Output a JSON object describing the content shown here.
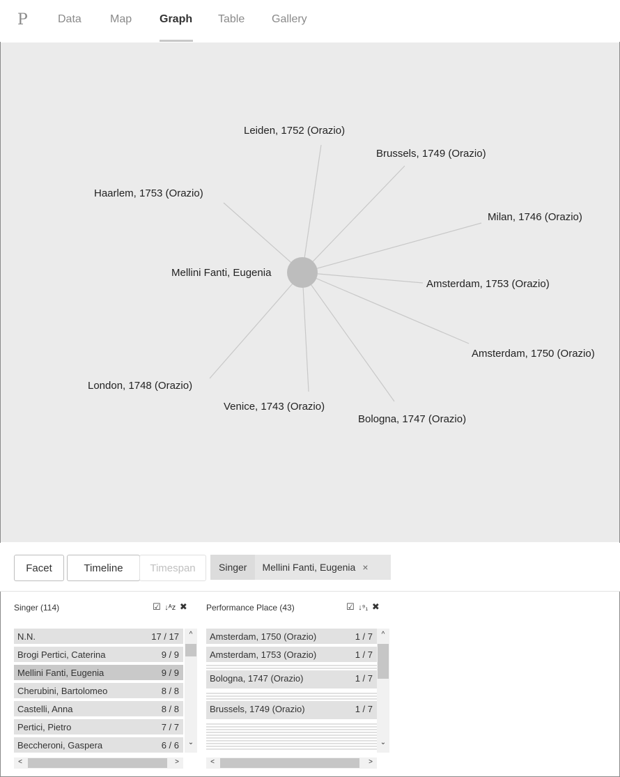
{
  "nav": {
    "logo": "P",
    "tabs": [
      {
        "label": "Data"
      },
      {
        "label": "Map"
      },
      {
        "label": "Graph"
      },
      {
        "label": "Table"
      },
      {
        "label": "Gallery"
      }
    ],
    "active_tab": "Graph"
  },
  "graph": {
    "center": "Mellini Fanti, Eugenia",
    "nodes": [
      "Leiden, 1752 (Orazio)",
      "Brussels, 1749 (Orazio)",
      "Haarlem, 1753 (Orazio)",
      "Milan, 1746 (Orazio)",
      "Amsterdam, 1753 (Orazio)",
      "Amsterdam, 1750 (Orazio)",
      "London, 1748 (Orazio)",
      "Venice, 1743 (Orazio)",
      "Bologna, 1747 (Orazio)"
    ]
  },
  "controls": {
    "facet_label": "Facet",
    "timeline_label": "Timeline",
    "timespan_label": "Timespan",
    "filter": {
      "key": "Singer",
      "value": "Mellini Fanti, Eugenia",
      "remove": "×"
    }
  },
  "facets": {
    "singer": {
      "title": "Singer (114)",
      "rows": [
        {
          "name": "N.N.",
          "count": "17 / 17"
        },
        {
          "name": "Brogi Pertici, Caterina",
          "count": "9 / 9"
        },
        {
          "name": "Mellini Fanti, Eugenia",
          "count": "9 / 9"
        },
        {
          "name": "Cherubini, Bartolomeo",
          "count": "8 / 8"
        },
        {
          "name": "Castelli, Anna",
          "count": "8 / 8"
        },
        {
          "name": "Pertici, Pietro",
          "count": "7 / 7"
        },
        {
          "name": "Beccheroni, Gaspera",
          "count": "6 / 6"
        }
      ]
    },
    "place": {
      "title": "Performance Place (43)",
      "rows": [
        {
          "name": "Amsterdam, 1750 (Orazio)",
          "count": "1 / 7"
        },
        {
          "name": "Amsterdam, 1753 (Orazio)",
          "count": "1 / 7"
        },
        {
          "name": "Bologna, 1747 (Orazio)",
          "count": "1 / 7"
        },
        {
          "name": "Brussels, 1749 (Orazio)",
          "count": "1 / 7"
        }
      ]
    }
  },
  "icons": {
    "check": "☑",
    "sort_alpha": "↓ᴬz",
    "sort_num": "↓⁹₁",
    "close": "✖",
    "up": "^",
    "down": "⌄",
    "left": "<",
    "right": ">"
  }
}
